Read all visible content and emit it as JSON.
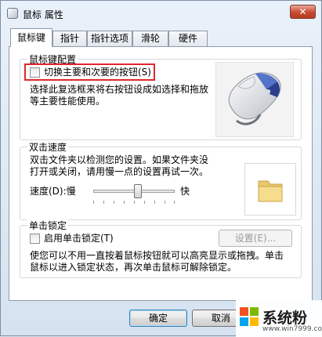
{
  "window": {
    "title": "鼠标 属性",
    "close_glyph": "✕"
  },
  "tabs": [
    {
      "label": "鼠标键",
      "active": true
    },
    {
      "label": "指针"
    },
    {
      "label": "指针选项"
    },
    {
      "label": "滑轮"
    },
    {
      "label": "硬件"
    }
  ],
  "button_config": {
    "title": "鼠标键配置",
    "checkbox_label": "切换主要和次要的按钮(S)",
    "desc_line1": "选择此复选框来将右按钮设成如选择和拖放",
    "desc_line2": "等主要性能使用。"
  },
  "double_click": {
    "title": "双击速度",
    "desc_line1": "双击文件夹以检测您的设置。如果文件夹没",
    "desc_line2": "打开或关闭，请用慢一点的设置再试一次。",
    "speed_label": "速度(D):慢",
    "fast_label": "快",
    "speed_level": 0.55
  },
  "click_lock": {
    "title": "单击锁定",
    "checkbox_label": "启用单击锁定(T)",
    "settings_button": "设置(E)...",
    "desc_line1": "使您可以不用一直按着鼠标按钮就可以高亮显示或拖拽。单击",
    "desc_line2": "鼠标以进入锁定状态，再次单击鼠标可解除锁定。"
  },
  "footer": {
    "ok": "确定",
    "cancel": "取消"
  },
  "watermark": {
    "text": "系统粉",
    "url": "www.win7999.com"
  },
  "colors": {
    "highlight": "#e0262d",
    "accent": "#3b5fc4"
  }
}
